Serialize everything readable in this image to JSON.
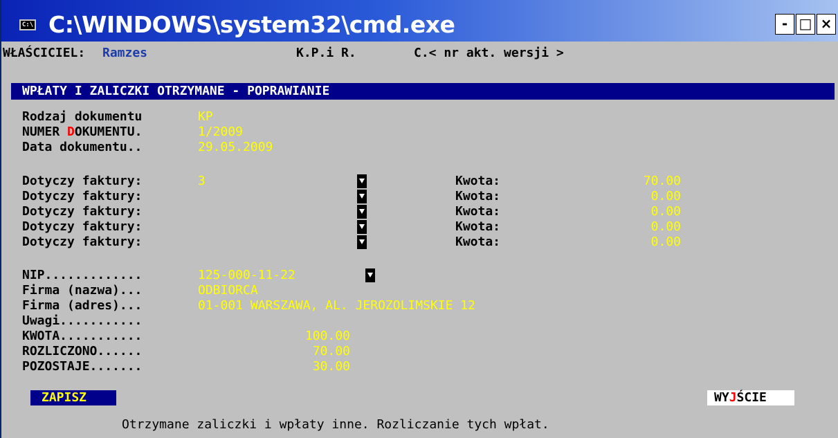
{
  "window": {
    "title": "C:\\WINDOWS\\system32\\cmd.exe",
    "icon_text": "C:\\",
    "minimize": "-",
    "maximize": "□",
    "close": "×"
  },
  "header": {
    "owner_label": "WŁAŚCICIEL:",
    "owner_name": "Ramzes",
    "app_name": "K.P.i R.",
    "version": "C.< nr akt. wersji >"
  },
  "section_title": "WPŁATY I ZALICZKI OTRZYMANE - POPRAWIANIE",
  "document": {
    "type_label": "Rodzaj dokumentu",
    "type_value": "KP",
    "number_label_a": "NUMER ",
    "number_label_hot": "D",
    "number_label_b": "OKUMENTU.",
    "number_value": "1/2009",
    "date_label": "Data dokumentu..",
    "date_value": "29.05.2009"
  },
  "invoices": [
    {
      "label": "Dotyczy faktury:",
      "value": "3",
      "amount_label": "Kwota:",
      "amount": "70.00"
    },
    {
      "label": "Dotyczy faktury:",
      "value": "",
      "amount_label": "Kwota:",
      "amount": "0.00"
    },
    {
      "label": "Dotyczy faktury:",
      "value": "",
      "amount_label": "Kwota:",
      "amount": "0.00"
    },
    {
      "label": "Dotyczy faktury:",
      "value": "",
      "amount_label": "Kwota:",
      "amount": "0.00"
    },
    {
      "label": "Dotyczy faktury:",
      "value": "",
      "amount_label": "Kwota:",
      "amount": "0.00"
    }
  ],
  "company": {
    "nip_label": "NIP.............",
    "nip_value": "125-000-11-22",
    "name_label": "Firma (nazwa)...",
    "name_value": "ODBIORCA",
    "address_label": "Firma (adres)...",
    "address_value": "01-001 WARSZAWA, AL. JEROZOLIMSKIE 12",
    "notes_label": "Uwagi...........",
    "notes_value": "",
    "amount_label": "KWOTA...........",
    "amount_value": "100.00",
    "settled_label": "ROZLICZONO......",
    "settled_value": "70.00",
    "remaining_label": "POZOSTAJE.......",
    "remaining_value": "30.00"
  },
  "buttons": {
    "save": "ZAPISZ",
    "exit_a": "WY",
    "exit_hot": "J",
    "exit_b": "ŚCIE"
  },
  "status_line": "Otrzymane zaliczki i wpłaty inne. Rozliczanie tych wpłat.",
  "colors": {
    "title_gradient_start": "#0a24b6",
    "title_gradient_end": "#a6c2f0",
    "console_bg": "#c0c0c0",
    "field_value": "#ffff00",
    "header_bar": "#00008b",
    "hotkey": "#ff0000",
    "owner_name": "#1e3ca8"
  }
}
